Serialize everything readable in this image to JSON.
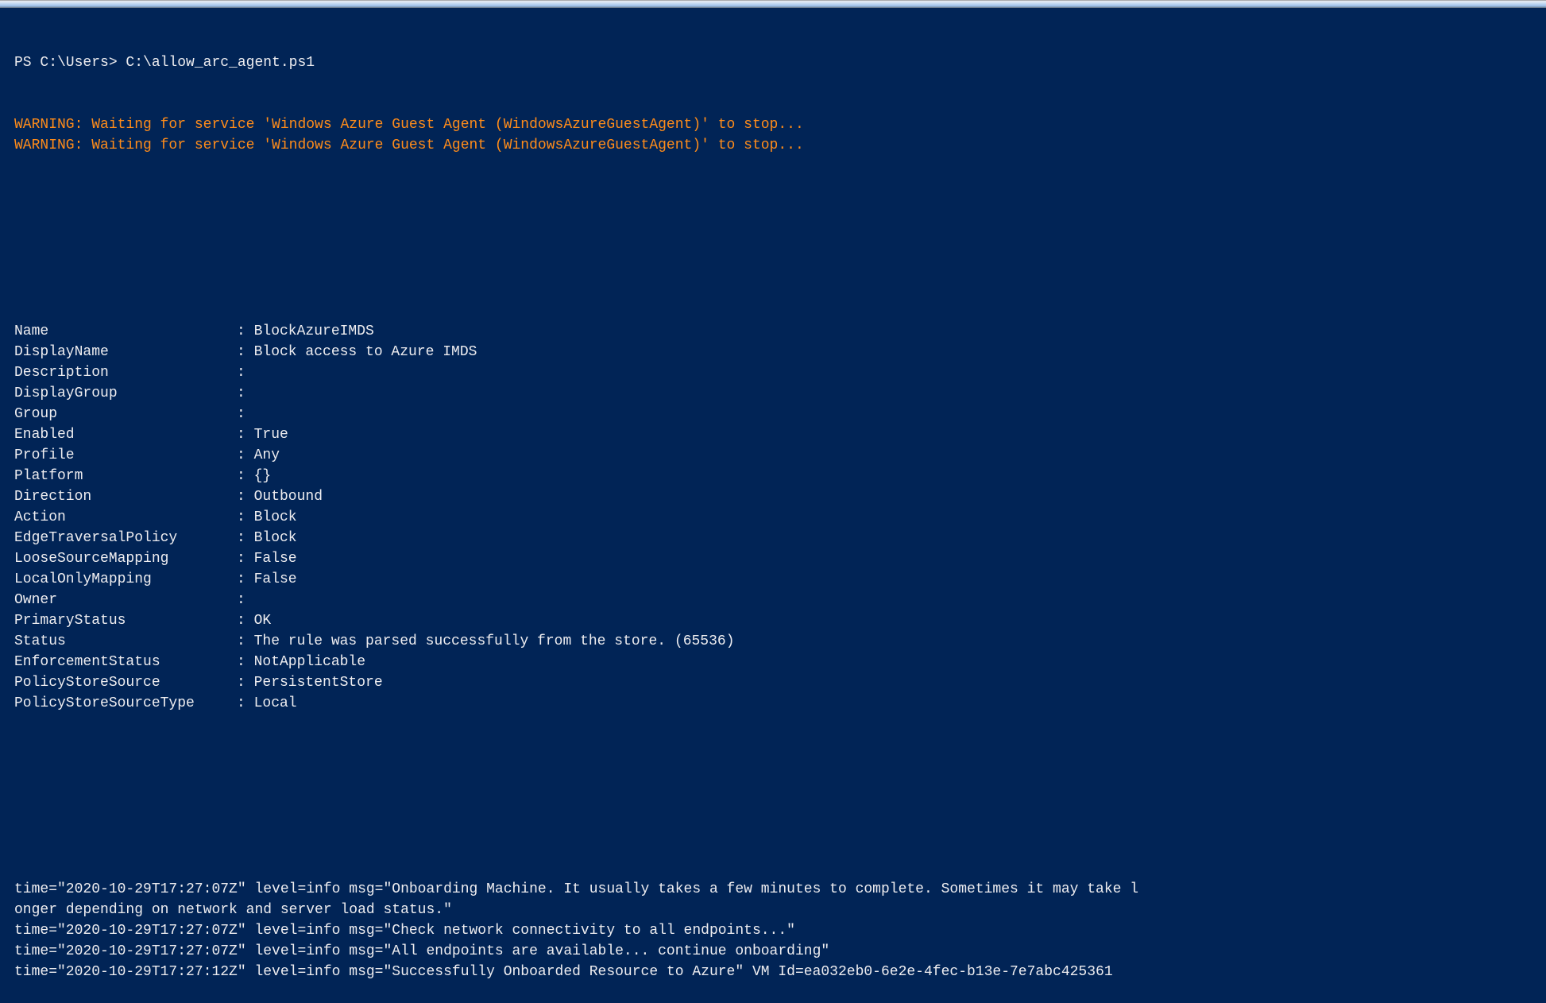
{
  "colors": {
    "background": "#012456",
    "text": "#eeedf0",
    "warning": "#ff8c1a"
  },
  "prompt": "PS C:\\Users> C:\\allow_arc_agent.ps1",
  "warnings": [
    "WARNING: Waiting for service 'Windows Azure Guest Agent (WindowsAzureGuestAgent)' to stop...",
    "WARNING: Waiting for service 'Windows Azure Guest Agent (WindowsAzureGuestAgent)' to stop..."
  ],
  "rule": [
    {
      "key": "Name",
      "value": ": BlockAzureIMDS"
    },
    {
      "key": "DisplayName",
      "value": ": Block access to Azure IMDS"
    },
    {
      "key": "Description",
      "value": ":"
    },
    {
      "key": "DisplayGroup",
      "value": ":"
    },
    {
      "key": "Group",
      "value": ":"
    },
    {
      "key": "Enabled",
      "value": ": True"
    },
    {
      "key": "Profile",
      "value": ": Any"
    },
    {
      "key": "Platform",
      "value": ": {}"
    },
    {
      "key": "Direction",
      "value": ": Outbound"
    },
    {
      "key": "Action",
      "value": ": Block"
    },
    {
      "key": "EdgeTraversalPolicy",
      "value": ": Block"
    },
    {
      "key": "LooseSourceMapping",
      "value": ": False"
    },
    {
      "key": "LocalOnlyMapping",
      "value": ": False"
    },
    {
      "key": "Owner",
      "value": ":"
    },
    {
      "key": "PrimaryStatus",
      "value": ": OK"
    },
    {
      "key": "Status",
      "value": ": The rule was parsed successfully from the store. (65536)"
    },
    {
      "key": "EnforcementStatus",
      "value": ": NotApplicable"
    },
    {
      "key": "PolicyStoreSource",
      "value": ": PersistentStore"
    },
    {
      "key": "PolicyStoreSourceType",
      "value": ": Local"
    }
  ],
  "log": [
    "time=\"2020-10-29T17:27:07Z\" level=info msg=\"Onboarding Machine. It usually takes a few minutes to complete. Sometimes it may take l",
    "onger depending on network and server load status.\"",
    "time=\"2020-10-29T17:27:07Z\" level=info msg=\"Check network connectivity to all endpoints...\"",
    "time=\"2020-10-29T17:27:07Z\" level=info msg=\"All endpoints are available... continue onboarding\"",
    "time=\"2020-10-29T17:27:12Z\" level=info msg=\"Successfully Onboarded Resource to Azure\" VM Id=ea032eb0-6e2e-4fec-b13e-7e7abc425361"
  ]
}
